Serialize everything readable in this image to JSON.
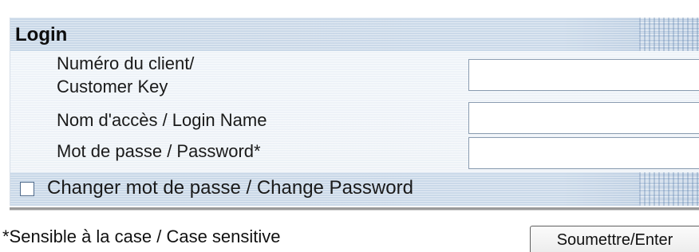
{
  "login": {
    "title": "Login",
    "fields": {
      "customer_key_label_line1": "Numéro du client/",
      "customer_key_label_line2": "Customer Key",
      "customer_key_value": "",
      "login_name_label": "Nom d'accès / Login Name",
      "login_name_value": "",
      "password_label": "Mot de passe / Password*",
      "password_value": ""
    },
    "change_password": {
      "label": "Changer mot de passe / Change Password",
      "checked": false
    }
  },
  "footer": {
    "note": "*Sensible à la case / Case sensitive",
    "submit_label": "Soumettre/Enter"
  },
  "colors": {
    "panel_background": "#edf2f7",
    "band_background": "#c9d8e8",
    "input_border": "#8a9cb0"
  }
}
